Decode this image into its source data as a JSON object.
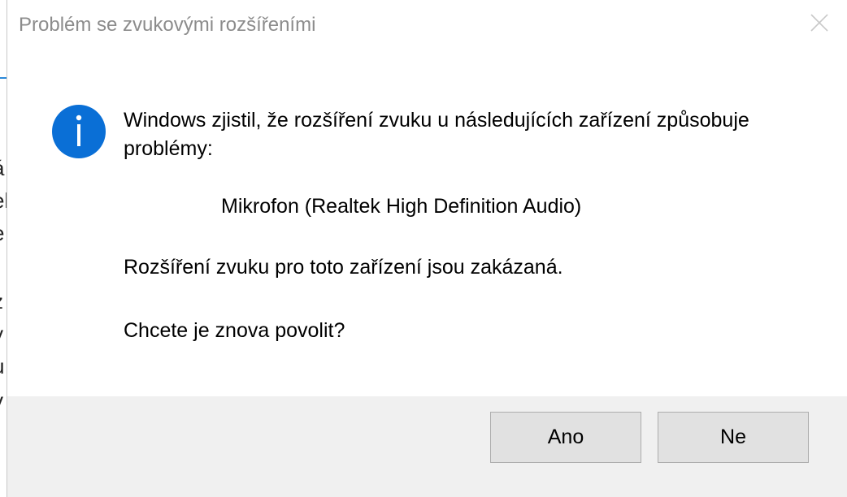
{
  "dialog": {
    "title": "Problém se zvukovými rozšířeními",
    "message": "Windows zjistil, že rozšíření zvuku u následujících zařízení způsobuje problémy:",
    "device": "Mikrofon (Realtek High Definition Audio)",
    "status_text": "Rozšíření zvuku pro toto zařízení jsou zakázaná.",
    "question": "Chcete je znova povolit?",
    "buttons": {
      "yes_label": "Ano",
      "no_label": "Ne"
    },
    "icons": {
      "info": "info-icon",
      "close": "close-icon"
    },
    "colors": {
      "info_icon": "#0a6fd6",
      "footer": "#f0f0f0",
      "button": "#e1e1e1",
      "title_text": "#8c8c8c"
    }
  },
  "background_window": {
    "fragments": [
      "á",
      "el",
      "e",
      "z",
      "y",
      "u",
      "v"
    ]
  }
}
